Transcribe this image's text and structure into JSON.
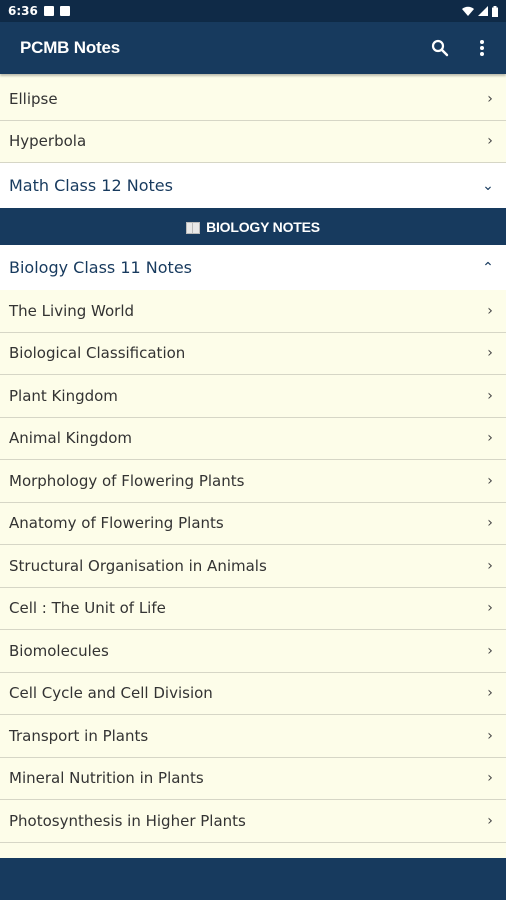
{
  "status": {
    "time": "6:36"
  },
  "app": {
    "title": "PCMB Notes",
    "icons": {
      "search": "search-icon",
      "menu": "more-vert-icon"
    },
    "colors": {
      "primary": "#173a5e",
      "background": "#fdfde9"
    }
  },
  "math_tail": [
    {
      "label": "Ellipse"
    },
    {
      "label": "Hyperbola"
    }
  ],
  "math_class12": {
    "label": "Math Class 12 Notes",
    "expanded": false
  },
  "biology_section": {
    "label": "BIOLOGY NOTES"
  },
  "biology_class11": {
    "label": "Biology Class 11 Notes",
    "expanded": true,
    "items": [
      "The Living World",
      "Biological Classification",
      "Plant Kingdom",
      "Animal Kingdom",
      "Morphology of Flowering Plants",
      "Anatomy of Flowering Plants",
      "Structural Organisation in Animals",
      "Cell : The Unit of Life",
      "Biomolecules",
      "Cell Cycle and Cell Division",
      "Transport in Plants",
      "Mineral Nutrition in Plants",
      "Photosynthesis in Higher Plants"
    ]
  }
}
